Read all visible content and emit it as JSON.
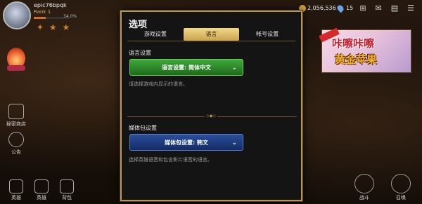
{
  "player": {
    "name": "epic76bpqk",
    "rank": "Rank 1",
    "xp_percent": 34.0,
    "xp_text": "34.0%",
    "stars": "✦ ★ ★"
  },
  "currency": {
    "gold": "2,056,536",
    "gems": "15"
  },
  "left_menu": [
    {
      "label": "秘密商店"
    },
    {
      "label": "公告"
    }
  ],
  "bottom_nav": [
    {
      "label": "英雄"
    },
    {
      "label": "英雄"
    },
    {
      "label": "背包"
    }
  ],
  "right_nav": [
    {
      "label": "战斗"
    },
    {
      "label": "召唤"
    }
  ],
  "banner": {
    "tag": "",
    "line1": "咔嚓咔嚓",
    "line2": "黄金苹果"
  },
  "dialog": {
    "title": "选项",
    "tabs": [
      {
        "label": "游戏设置",
        "active": false
      },
      {
        "label": "语言",
        "active": true
      },
      {
        "label": "帐号设置",
        "active": false
      }
    ],
    "language_section": {
      "label": "语言设置",
      "dropdown": "语言设置: 简体中文",
      "hint": "请选择游戏内显示的语言。"
    },
    "media_section": {
      "label": "媒体包设置",
      "dropdown": "媒体包设置: 韩文",
      "hint": "选择英雄语音和包含影片语音的语言。"
    }
  },
  "colors": {
    "accent_gold": "#b89558",
    "active_tab": "#e2c070",
    "green_dropdown": "#2f8a2a",
    "blue_dropdown": "#1e3c80"
  }
}
